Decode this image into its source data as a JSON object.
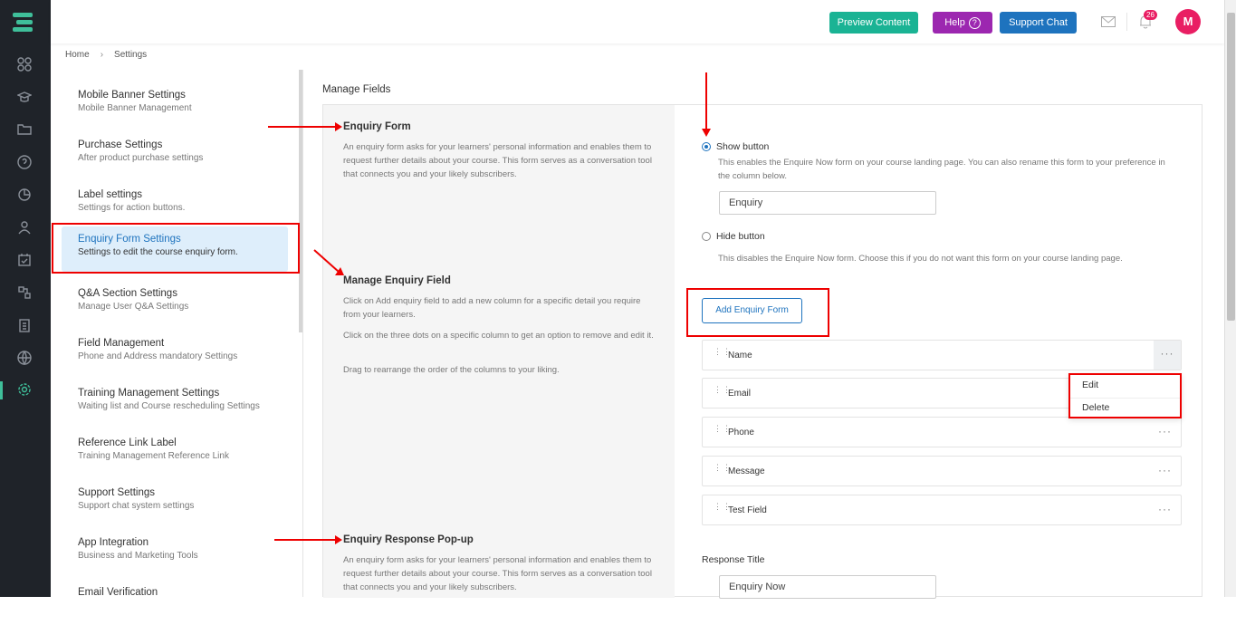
{
  "topbar": {
    "preview_label": "Preview Content",
    "help_label": "Help",
    "help_icon_char": "?",
    "support_label": "Support Chat",
    "notification_count": "26",
    "avatar_initial": "M"
  },
  "breadcrumb": {
    "home": "Home",
    "current": "Settings"
  },
  "sidebar": {
    "items": [
      {
        "title": "Mobile Banner Settings",
        "subtitle": "Mobile Banner Management"
      },
      {
        "title": "Purchase Settings",
        "subtitle": "After product purchase settings"
      },
      {
        "title": "Label settings",
        "subtitle": "Settings for action buttons."
      },
      {
        "title": "Enquiry Form Settings",
        "subtitle": "Settings to edit the course enquiry form."
      },
      {
        "title": "Q&A Section Settings",
        "subtitle": "Manage User Q&A Settings"
      },
      {
        "title": "Field Management",
        "subtitle": "Phone and Address mandatory Settings"
      },
      {
        "title": "Training Management Settings",
        "subtitle": "Waiting list and Course rescheduling Settings"
      },
      {
        "title": "Reference Link Label",
        "subtitle": "Training Management Reference Link"
      },
      {
        "title": "Support Settings",
        "subtitle": "Support chat system settings"
      },
      {
        "title": "App Integration",
        "subtitle": "Business and Marketing Tools"
      },
      {
        "title": "Email Verification",
        "subtitle": ""
      }
    ]
  },
  "main": {
    "title": "Manage Fields",
    "enquiry_form": {
      "title": "Enquiry Form",
      "desc": "An enquiry form asks for your learners' personal information and enables them to request further details about your course. This form serves as a conversation tool that connects you and your likely subscribers."
    },
    "show_button": {
      "label": "Show button",
      "desc": "This enables the Enquire Now form on your course landing page. You can also rename this form to your preference in the column below.",
      "input_value": "Enquiry"
    },
    "hide_button": {
      "label": "Hide button",
      "desc": "This disables the Enquire Now form. Choose this if you do not want this form on your course landing page."
    },
    "manage_field": {
      "title": "Manage Enquiry Field",
      "desc1": "Click on Add enquiry field to add a new column for a specific detail you require from your learners.",
      "desc2": "Click on the three dots on a specific column to get an option to remove and edit it.",
      "desc3": "Drag to rearrange the order of the columns to your liking."
    },
    "add_button_label": "Add Enquiry Form",
    "fields": [
      "Name",
      "Email",
      "Phone",
      "Message",
      "Test Field"
    ],
    "menu": {
      "edit": "Edit",
      "delete": "Delete"
    },
    "response_popup": {
      "title": "Enquiry Response Pop-up",
      "desc": "An enquiry form asks for your learners' personal information and enables them to request further details about your course. This form serves as a conversation tool that connects you and your likely subscribers."
    },
    "response_title": {
      "label": "Response Title",
      "input_value": "Enquiry Now"
    }
  },
  "colors": {
    "accent": "#1e73be",
    "brand_green": "#3fbf9a",
    "annotation_red": "#e00"
  }
}
